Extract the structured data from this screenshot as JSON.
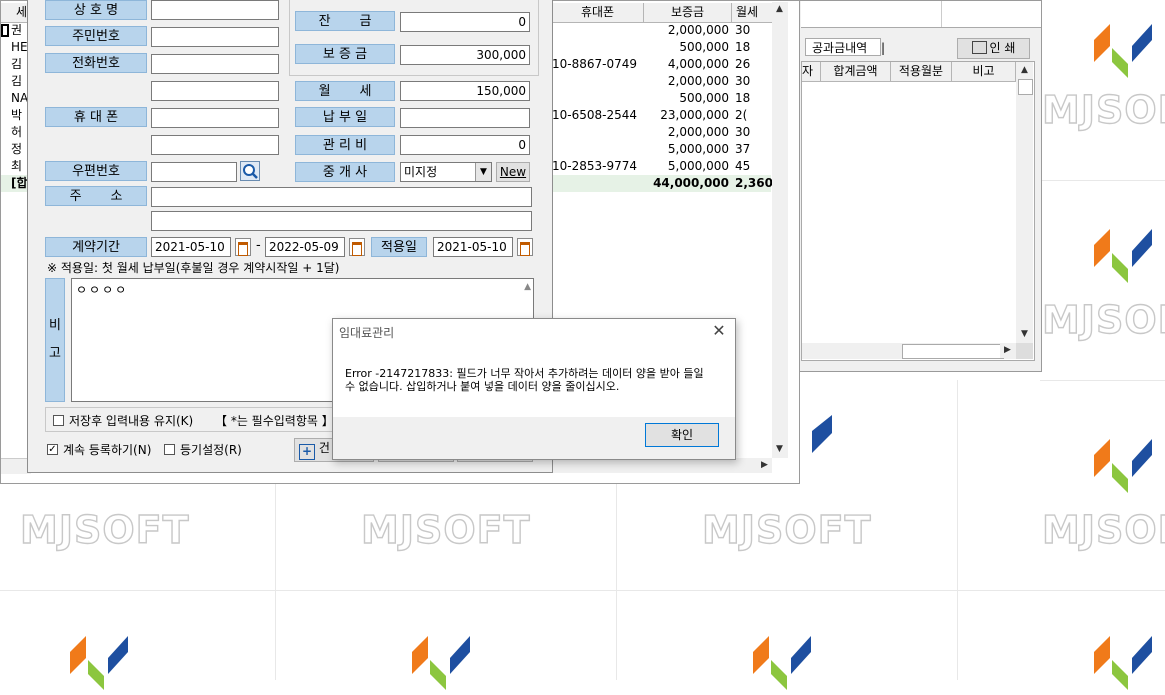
{
  "watermark": {
    "brand": "MJSOFT"
  },
  "grid": {
    "headers": {
      "col_name": "세",
      "col_phone": "휴대폰",
      "col_deposit": "보증금",
      "col_rent": "월세"
    },
    "rows": [
      {
        "name": "권",
        "phone": "",
        "deposit": "2,000,000",
        "rent": "30"
      },
      {
        "name": "HE",
        "phone": "",
        "deposit": "500,000",
        "rent": "18"
      },
      {
        "name": "김",
        "phone": "10-8867-0749",
        "deposit": "4,000,000",
        "rent": "26"
      },
      {
        "name": "김",
        "phone": "",
        "deposit": "2,000,000",
        "rent": "30"
      },
      {
        "name": "NA",
        "phone": "",
        "deposit": "500,000",
        "rent": "18"
      },
      {
        "name": "박",
        "phone": "10-6508-2544",
        "deposit": "23,000,000",
        "rent": "2("
      },
      {
        "name": "허",
        "phone": "",
        "deposit": "2,000,000",
        "rent": "30"
      },
      {
        "name": "정",
        "phone": "",
        "deposit": "5,000,000",
        "rent": "37"
      },
      {
        "name": "최",
        "phone": "10-2853-9774",
        "deposit": "5,000,000",
        "rent": "45"
      }
    ],
    "total": {
      "name": "[합",
      "deposit": "44,000,000",
      "rent": "2,360"
    }
  },
  "right_panel": {
    "tab_label": "공과금내역",
    "print_label": "인 쇄",
    "headers": {
      "c0": "자",
      "c1": "합계금액",
      "c2": "적용월분",
      "c3": "비고"
    }
  },
  "form": {
    "labels": {
      "name": "상 호 명",
      "resident_no": "주민번호",
      "phone": "전화번호",
      "mobile": "휴 대 폰",
      "postal": "우편번호",
      "address": "주       소",
      "period": "계약기간",
      "memo": "비\n\n고",
      "balance": "잔       금",
      "deposit": "보 증 금",
      "rent": "월       세",
      "due_day": "납 부 일",
      "mgmt_fee": "관 리 비",
      "agent": "중 개 사",
      "apply_day": "적용일"
    },
    "values": {
      "balance": "0",
      "deposit": "300,000",
      "rent": "150,000",
      "mgmt_fee": "0",
      "agent": "미지정",
      "start_date": "2021-05-10",
      "end_date": "2022-05-09",
      "apply_date": "2021-05-10",
      "memo": "ㅇㅇㅇㅇ"
    },
    "new_button": "New",
    "date_sep": "-",
    "note": "※ 적용일: 첫 월세 납부일(후불일 경우 계약시작일 + 1달)",
    "keep_input_label": "저장후 입력내용 유지(K)",
    "required_note": "【 *는 필수입력항목 】",
    "continue_register_label": "계속 등록하기(N)",
    "registry_label": "등기설정(R)",
    "add_button_label": "건"
  },
  "dialog": {
    "title": "임대료관리",
    "message": "Error -2147217833: 필드가 너무 작아서 추가하려는 데이터 양을 받아 들일 수 없습니다. 삽입하거나 붙여 넣을 데이터 양을 줄이십시오.",
    "ok_label": "확인"
  },
  "colors": {
    "label_bg": "#b8d4ec",
    "logo_orange": "#f07a1a",
    "logo_green": "#8cc63f",
    "logo_blue": "#1e4fa0"
  }
}
